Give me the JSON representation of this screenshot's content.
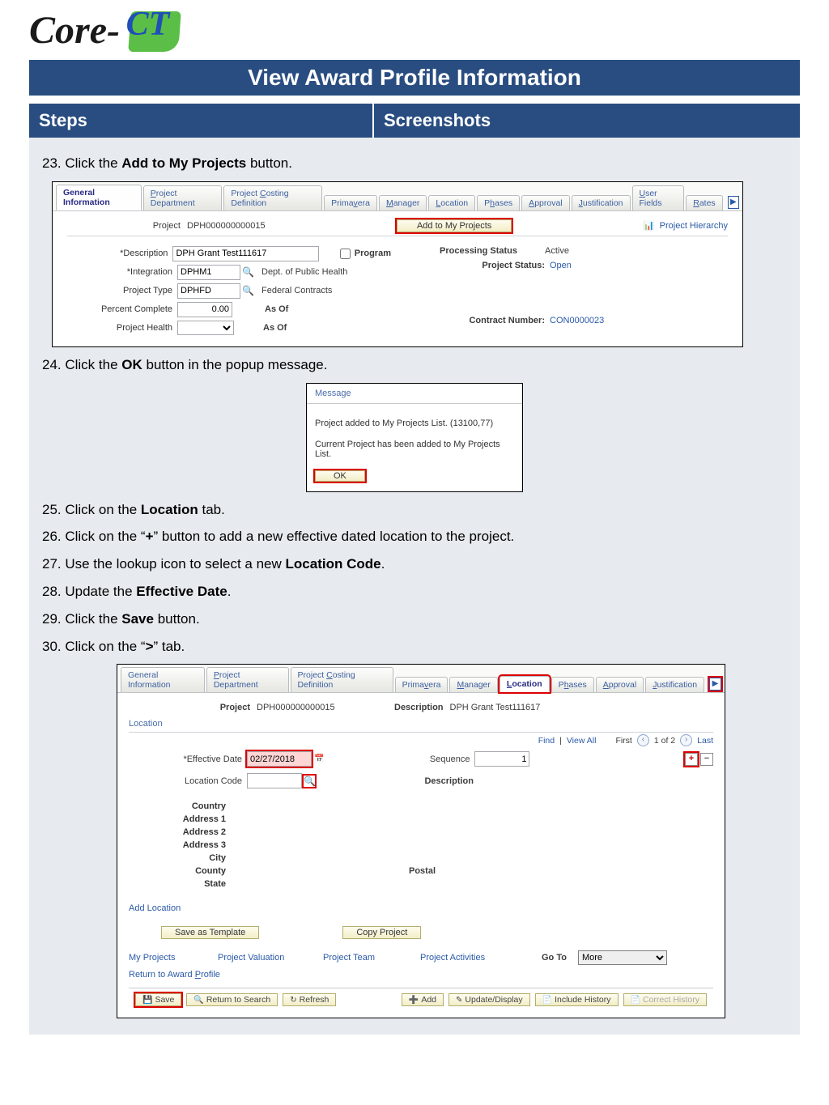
{
  "logo": {
    "text": "Core-",
    "ct": "CT"
  },
  "title": "View Award Profile Information",
  "columns": {
    "left": "Steps",
    "right": "Screenshots"
  },
  "steps": {
    "s23a": "23. Click the ",
    "s23b": "Add to My Projects",
    "s23c": " button.",
    "s24a": "24. Click the ",
    "s24b": "OK",
    "s24c": " button in the popup message.",
    "s25a": "25. Click on the ",
    "s25b": "Location",
    "s25c": " tab.",
    "s26a": "26. Click on the “",
    "s26b": "+",
    "s26c": "” button to add a new effective dated location to the project.",
    "s27a": "27. Use the lookup icon to select a new ",
    "s27b": "Location Code",
    "s27c": ".",
    "s28a": "28. Update the ",
    "s28b": "Effective Date",
    "s28c": ".",
    "s29a": "29. Click the ",
    "s29b": "Save",
    "s29c": " button.",
    "s30a": "30. Click on the “",
    "s30b": ">",
    "s30c": "” tab."
  },
  "shot1": {
    "tabs": {
      "general": "General Information",
      "dept_pref": "P",
      "dept_mid": "roject Department",
      "cost_pref": "Project ",
      "cost_u": "C",
      "cost_suf": "osting Definition",
      "prim_pre": "Prima",
      "prim_u": "v",
      "prim_suf": "era",
      "mgr_u": "M",
      "mgr_suf": "anager",
      "loc_u": "L",
      "loc_suf": "ocation",
      "phase_pre": "P",
      "phase_u": "h",
      "phase_suf": "ases",
      "appr_u": "A",
      "appr_suf": "pproval",
      "just_u": "J",
      "just_suf": "ustification",
      "user_u": "U",
      "user_suf": "ser Fields",
      "rates_u": "R",
      "rates_suf": "ates"
    },
    "project_lbl": "Project",
    "project_val": "DPH000000000015",
    "addbtn": "Add to My Projects",
    "hierarchy": "Project Hierarchy",
    "desc_lbl": "*Description",
    "desc_val": "DPH Grant Test111617",
    "program_lbl": "Program",
    "integ_lbl": "*Integration",
    "integ_val": "DPHM1",
    "integ_desc": "Dept. of Public Health",
    "ptype_lbl": "Project Type",
    "ptype_val": "DPHFD",
    "ptype_desc": "Federal Contracts",
    "pct_lbl": "Percent Complete",
    "pct_val": "0.00",
    "asof": "As Of",
    "health_lbl": "Project Health",
    "proc_lbl": "Processing Status",
    "proc_val": "Active",
    "pstat_lbl": "Project Status:",
    "pstat_val": "Open",
    "contract_lbl": "Contract Number:",
    "contract_val": "CON0000023"
  },
  "msg": {
    "title": "Message",
    "line1": "Project added to My Projects List. (13100,77)",
    "line2": "Current Project has been added to My Projects List.",
    "ok": "OK"
  },
  "shot2": {
    "tabs": {
      "general": "General Information",
      "dept_pref": "P",
      "dept_mid": "roject Department",
      "cost_pref": "Project ",
      "cost_u": "C",
      "cost_suf": "osting Definition",
      "prim_pre": "Prima",
      "prim_u": "v",
      "prim_suf": "era",
      "mgr_u": "M",
      "mgr_suf": "anager",
      "loc_u": "L",
      "loc_suf": "ocation",
      "phase_pre": "P",
      "phase_u": "h",
      "phase_suf": "ases",
      "appr_u": "A",
      "appr_suf": "pproval",
      "just_u": "J",
      "just_suf": "ustification"
    },
    "project_lbl": "Project",
    "project_val": "DPH000000000015",
    "desc_lbl": "Description",
    "desc_val": "DPH Grant Test111617",
    "section": "Location",
    "find": "Find",
    "viewall": "View All",
    "first": "First",
    "pager": "1 of 2",
    "last": "Last",
    "eff_lbl": "*Effective Date",
    "eff_val": "02/27/2018",
    "seq_lbl": "Sequence",
    "seq_val": "1",
    "loccode_lbl": "Location Code",
    "desc2_lbl": "Description",
    "country": "Country",
    "addr1": "Address 1",
    "addr2": "Address 2",
    "addr3": "Address 3",
    "city": "City",
    "county": "County",
    "postal": "Postal",
    "state": "State",
    "addloc": "Add Location",
    "savetmpl": "Save as Template",
    "copyproj": "Copy Project",
    "myproj": "My Projects",
    "projval": "Project Valuation",
    "projteam": "Project Team",
    "projact": "Project Activities",
    "goto": "Go To",
    "more": "More",
    "return_pre": "Return to Award ",
    "return_u": "P",
    "return_suf": "rofile",
    "save": "Save",
    "rts": "Return to Search",
    "refresh": "Refresh",
    "add": "Add",
    "update": "Update/Display",
    "include": "Include History",
    "correct": "Correct History"
  }
}
